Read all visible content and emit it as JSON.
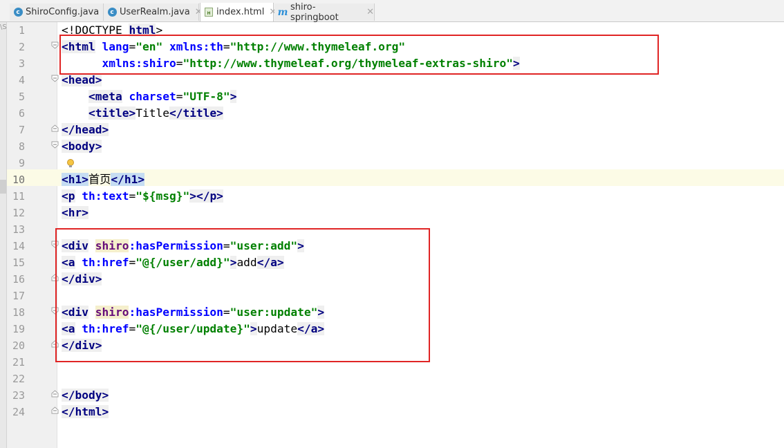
{
  "tabs": [
    {
      "label": "ShiroConfig.java",
      "icon": "java-class-icon",
      "active": false
    },
    {
      "label": "UserRealm.java",
      "icon": "java-class-icon",
      "active": false
    },
    {
      "label": "index.html",
      "icon": "html-file-icon",
      "active": true
    },
    {
      "label": "shiro-springboot",
      "icon": "maven-module-icon",
      "active": false
    }
  ],
  "gutter": {
    "left_marker": "\\S"
  },
  "line_numbers": [
    "1",
    "2",
    "3",
    "4",
    "5",
    "6",
    "7",
    "8",
    "9",
    "10",
    "11",
    "12",
    "13",
    "14",
    "15",
    "16",
    "17",
    "18",
    "19",
    "20",
    "21",
    "22",
    "23",
    "24"
  ],
  "current_line": "10",
  "code": {
    "l1": {
      "p1": "<!DOCTYPE ",
      "p2": "html",
      "p3": ">"
    },
    "l2": {
      "open": "<html",
      "sp1": " ",
      "a1": "lang",
      "eq1": "=",
      "v1": "\"en\"",
      "sp2": " ",
      "a2": "xmlns:th",
      "eq2": "=",
      "v2": "\"http://www.thymeleaf.org\""
    },
    "l3": {
      "indent": "      ",
      "a1": "xmlns:shiro",
      "eq": "=",
      "v1": "\"http://www.thymeleaf.org/thymeleaf-extras-shiro\"",
      "close": ">"
    },
    "l4": {
      "tag": "<head>"
    },
    "l5": {
      "indent": "    ",
      "open": "<meta",
      "sp": " ",
      "a1": "charset",
      "eq": "=",
      "v1": "\"UTF-8\"",
      "close": ">"
    },
    "l6": {
      "indent": "    ",
      "open": "<title>",
      "text": "Title",
      "close": "</title>"
    },
    "l7": {
      "tag": "</head>"
    },
    "l8": {
      "tag": "<body>"
    },
    "l10": {
      "open": "<h1>",
      "text": "首页",
      "close": "</h1>"
    },
    "l11": {
      "open": "<p",
      "sp": " ",
      "a1": "th:text",
      "eq": "=",
      "v1": "\"${msg}\"",
      "close": "></p>"
    },
    "l12": {
      "tag": "<hr>"
    },
    "l14": {
      "open": "<div",
      "sp": " ",
      "ns": "shiro",
      "a1": ":hasPermission",
      "eq": "=",
      "v1": "\"user:add\"",
      "close": ">"
    },
    "l15": {
      "open": "<a",
      "sp": " ",
      "a1": "th:href",
      "eq": "=",
      "v1": "\"@{/user/add}\"",
      "mid": ">",
      "text": "add",
      "close": "</a>"
    },
    "l16": {
      "tag": "</div>"
    },
    "l18": {
      "open": "<div",
      "sp": " ",
      "ns": "shiro",
      "a1": ":hasPermission",
      "eq": "=",
      "v1": "\"user:update\"",
      "close": ">"
    },
    "l19": {
      "open": "<a",
      "sp": " ",
      "a1": "th:href",
      "eq": "=",
      "v1": "\"@{/user/update}\"",
      "mid": ">",
      "text": "update",
      "close": "</a>"
    },
    "l20": {
      "tag": "</div>"
    },
    "l23": {
      "tag": "</body>"
    },
    "l24": {
      "tag": "</html>"
    }
  },
  "colors": {
    "tag": "#000080",
    "attribute": "#0000ff",
    "string": "#008000",
    "namespace": "#660e7a",
    "annotation_box": "#e02424",
    "current_line": "#fcfbe6"
  }
}
